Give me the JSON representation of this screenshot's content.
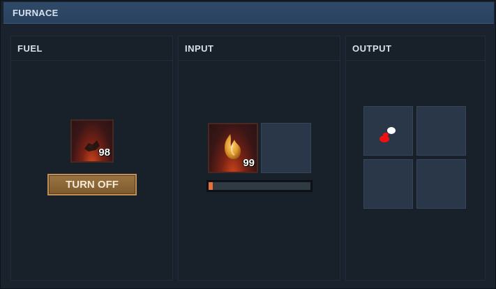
{
  "window": {
    "title": "FURNACE"
  },
  "fuel": {
    "title": "FUEL",
    "slot": {
      "item_icon": "charcoal-icon",
      "count": "98"
    },
    "toggle_button_label": "TURN OFF"
  },
  "input": {
    "title": "INPUT",
    "slots": [
      {
        "item_icon": "sulfur-ore-icon",
        "count": "99"
      },
      {
        "item_icon": "",
        "count": ""
      }
    ],
    "progress": 0.04
  },
  "output": {
    "title": "OUTPUT",
    "slots": [
      {
        "item_icon": "sulfur-icon",
        "count": ""
      },
      {
        "item_icon": "",
        "count": ""
      },
      {
        "item_icon": "",
        "count": ""
      },
      {
        "item_icon": "",
        "count": ""
      }
    ]
  },
  "colors": {
    "titlebar": "#2f4a68",
    "panel": "#182029",
    "slot": "#2a3748",
    "button": "#8a6436",
    "progress_fill": "#e8703a"
  }
}
